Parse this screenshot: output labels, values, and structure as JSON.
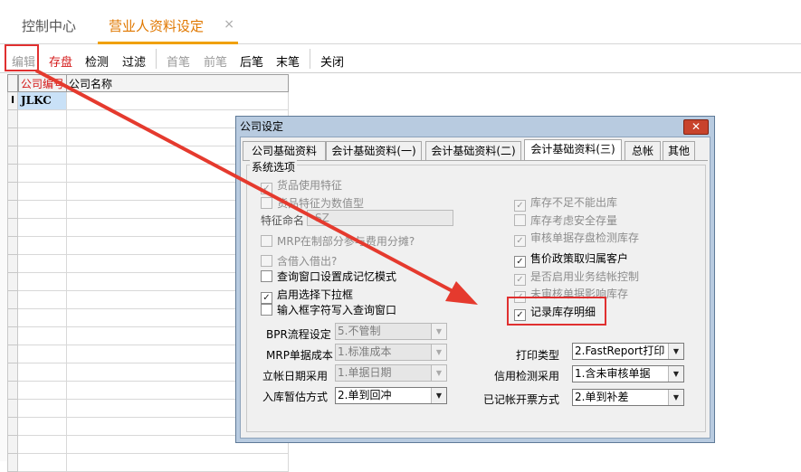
{
  "tabs": {
    "control_center": "控制中心",
    "sales_profile": "营业人资料设定",
    "close": "×"
  },
  "toolbar": {
    "edit": "编辑",
    "save": "存盘",
    "check": "检测",
    "filter": "过滤",
    "first": "首笔",
    "prev": "前笔",
    "next": "后笔",
    "last": "末笔",
    "close": "关闭"
  },
  "grid": {
    "col_code": "公司编号",
    "col_name": "公司名称",
    "row_marker": "I",
    "first_code": "JLKC"
  },
  "dialog": {
    "title": "公司设定",
    "close_icon": "✕",
    "tabs": [
      "公司基础资料",
      "会计基础资料(一)",
      "会计基础资料(二)",
      "会计基础资料(三)",
      "总帐",
      "其他"
    ],
    "group_label": "系统选项",
    "left_options": {
      "goods_features": "货品使用特征",
      "feature_numeric": "货品特征为数值型",
      "feature_name_label": "特征命名",
      "feature_name_value": "SZ",
      "mrp_share": "MRP在制部分参与费用分摊?",
      "borrow_in_out": "含借入借出?",
      "query_memory": "查询窗口设置成记忆模式",
      "dropdown": "启用选择下拉框",
      "input_query": "输入框字符写入查询窗口"
    },
    "right_options": {
      "no_negative_stock": "库存不足不能出库",
      "safety_stock": "库存考虑安全存量",
      "audit_check_stock": "审核单据存盘检测库存",
      "price_policy": "售价政策取归属客户",
      "business_close": "是否启用业务结帐控制",
      "unaudited_stock": "未审核单据影响库存",
      "record_stock_detail": "记录库存明细"
    },
    "fields": {
      "bpr_label": "BPR流程设定",
      "bpr_value": "5.不管制",
      "mrp_cost_label": "MRP单据成本",
      "mrp_cost_value": "1.标准成本",
      "account_date_label": "立帐日期采用",
      "account_date_value": "1.单据日期",
      "temp_estimate_label": "入库暂估方式",
      "temp_estimate_value": "2.单到回冲",
      "print_type_label": "打印类型",
      "print_type_value": "2.FastReport打印",
      "credit_check_label": "信用检测采用",
      "credit_check_value": "1.含未审核单据",
      "invoice_label": "已记帐开票方式",
      "invoice_value": "2.单到补差"
    },
    "check_mark": "✓",
    "dropdown_arrow": "▼"
  },
  "colors": {
    "accent_orange": "#f0a000",
    "highlight_red": "#e03030",
    "dialog_frame": "#b8cbe0"
  }
}
